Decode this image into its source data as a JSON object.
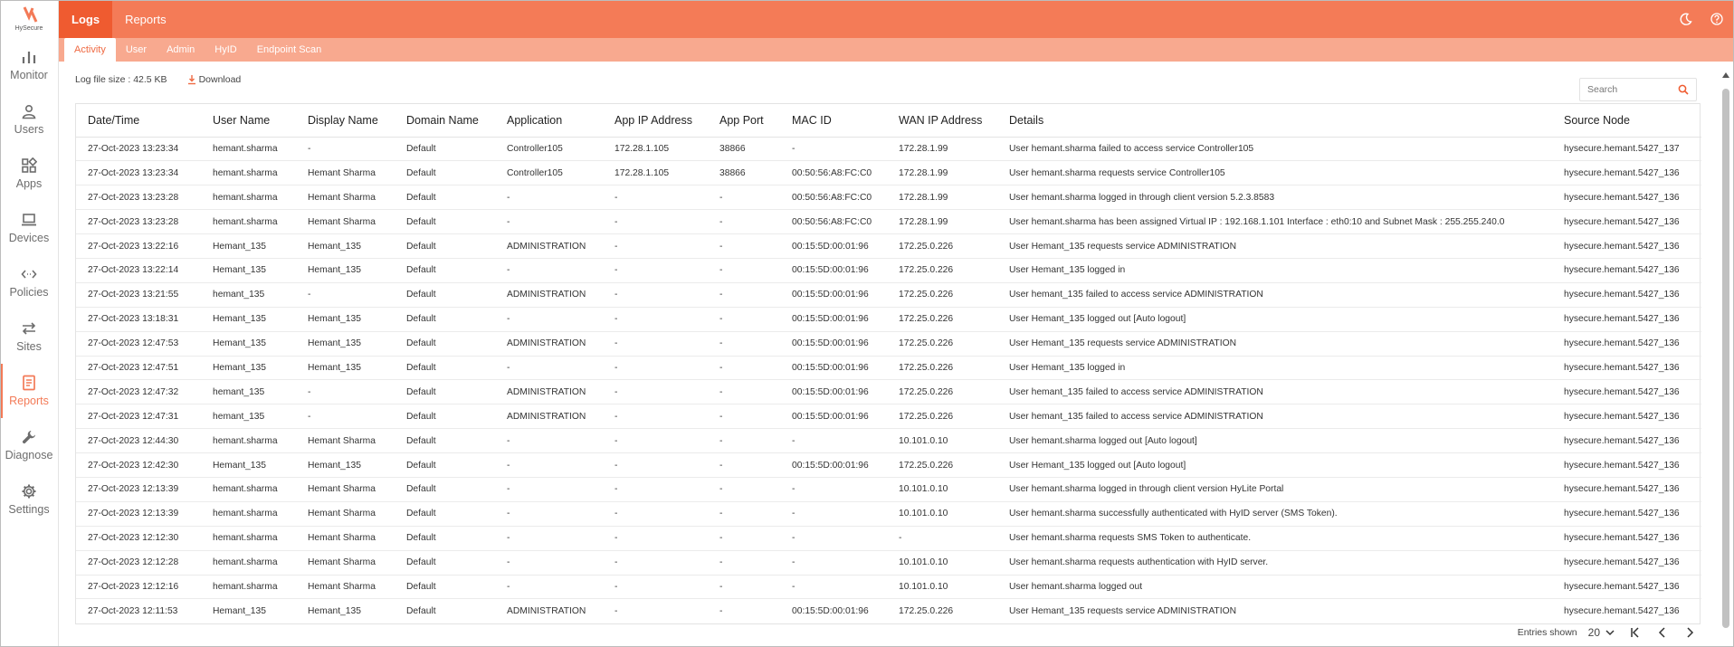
{
  "brand": {
    "name": "HySecure",
    "accent": "#f47b57",
    "accent_dark": "#ef5b30",
    "subbar": "#f8a98f"
  },
  "sidebar": {
    "items": [
      {
        "label": "Monitor",
        "icon": "bar-chart-icon"
      },
      {
        "label": "Users",
        "icon": "user-icon"
      },
      {
        "label": "Apps",
        "icon": "apps-grid-icon"
      },
      {
        "label": "Devices",
        "icon": "laptop-icon"
      },
      {
        "label": "Policies",
        "icon": "code-arrows-icon"
      },
      {
        "label": "Sites",
        "icon": "swap-arrows-icon"
      },
      {
        "label": "Reports",
        "icon": "report-icon",
        "active": true
      },
      {
        "label": "Diagnose",
        "icon": "wrench-icon"
      },
      {
        "label": "Settings",
        "icon": "gear-icon"
      }
    ]
  },
  "topbar": {
    "tabs": [
      {
        "label": "Logs",
        "active": true
      },
      {
        "label": "Reports"
      }
    ]
  },
  "subtabs": [
    {
      "label": "Activity",
      "active": true
    },
    {
      "label": "User"
    },
    {
      "label": "Admin"
    },
    {
      "label": "HyID"
    },
    {
      "label": "Endpoint Scan"
    }
  ],
  "toolbar": {
    "log_size": "Log file size : 42.5 KB",
    "download_label": "Download"
  },
  "search": {
    "placeholder": "Search"
  },
  "table": {
    "columns": [
      "Date/Time",
      "User Name",
      "Display Name",
      "Domain Name",
      "Application",
      "App IP Address",
      "App Port",
      "MAC ID",
      "WAN IP Address",
      "Details",
      "Source Node"
    ],
    "rows": [
      [
        "27-Oct-2023 13:23:34",
        "hemant.sharma",
        "-",
        "Default",
        "Controller105",
        "172.28.1.105",
        "38866",
        "-",
        "172.28.1.99",
        "User hemant.sharma failed to access service Controller105",
        "hysecure.hemant.5427_137"
      ],
      [
        "27-Oct-2023 13:23:34",
        "hemant.sharma",
        "Hemant Sharma",
        "Default",
        "Controller105",
        "172.28.1.105",
        "38866",
        "00:50:56:A8:FC:C0",
        "172.28.1.99",
        "User hemant.sharma requests service Controller105",
        "hysecure.hemant.5427_136"
      ],
      [
        "27-Oct-2023 13:23:28",
        "hemant.sharma",
        "Hemant Sharma",
        "Default",
        "-",
        "-",
        "-",
        "00:50:56:A8:FC:C0",
        "172.28.1.99",
        "User hemant.sharma logged in through client version 5.2.3.8583",
        "hysecure.hemant.5427_136"
      ],
      [
        "27-Oct-2023 13:23:28",
        "hemant.sharma",
        "Hemant Sharma",
        "Default",
        "-",
        "-",
        "-",
        "00:50:56:A8:FC:C0",
        "172.28.1.99",
        "User hemant.sharma has been assigned Virtual IP : 192.168.1.101 Interface : eth0:10 and Subnet Mask : 255.255.240.0",
        "hysecure.hemant.5427_136"
      ],
      [
        "27-Oct-2023 13:22:16",
        "Hemant_135",
        "Hemant_135",
        "Default",
        "ADMINISTRATION",
        "-",
        "-",
        "00:15:5D:00:01:96",
        "172.25.0.226",
        "User Hemant_135 requests service ADMINISTRATION",
        "hysecure.hemant.5427_136"
      ],
      [
        "27-Oct-2023 13:22:14",
        "Hemant_135",
        "Hemant_135",
        "Default",
        "-",
        "-",
        "-",
        "00:15:5D:00:01:96",
        "172.25.0.226",
        "User Hemant_135 logged in",
        "hysecure.hemant.5427_136"
      ],
      [
        "27-Oct-2023 13:21:55",
        "hemant_135",
        "-",
        "Default",
        "ADMINISTRATION",
        "-",
        "-",
        "00:15:5D:00:01:96",
        "172.25.0.226",
        "User hemant_135 failed to access service ADMINISTRATION",
        "hysecure.hemant.5427_136"
      ],
      [
        "27-Oct-2023 13:18:31",
        "Hemant_135",
        "Hemant_135",
        "Default",
        "-",
        "-",
        "-",
        "00:15:5D:00:01:96",
        "172.25.0.226",
        "User Hemant_135 logged out [Auto logout]",
        "hysecure.hemant.5427_136"
      ],
      [
        "27-Oct-2023 12:47:53",
        "Hemant_135",
        "Hemant_135",
        "Default",
        "ADMINISTRATION",
        "-",
        "-",
        "00:15:5D:00:01:96",
        "172.25.0.226",
        "User Hemant_135 requests service ADMINISTRATION",
        "hysecure.hemant.5427_136"
      ],
      [
        "27-Oct-2023 12:47:51",
        "Hemant_135",
        "Hemant_135",
        "Default",
        "-",
        "-",
        "-",
        "00:15:5D:00:01:96",
        "172.25.0.226",
        "User Hemant_135 logged in",
        "hysecure.hemant.5427_136"
      ],
      [
        "27-Oct-2023 12:47:32",
        "hemant_135",
        "-",
        "Default",
        "ADMINISTRATION",
        "-",
        "-",
        "00:15:5D:00:01:96",
        "172.25.0.226",
        "User hemant_135 failed to access service ADMINISTRATION",
        "hysecure.hemant.5427_136"
      ],
      [
        "27-Oct-2023 12:47:31",
        "hemant_135",
        "-",
        "Default",
        "ADMINISTRATION",
        "-",
        "-",
        "00:15:5D:00:01:96",
        "172.25.0.226",
        "User hemant_135 failed to access service ADMINISTRATION",
        "hysecure.hemant.5427_136"
      ],
      [
        "27-Oct-2023 12:44:30",
        "hemant.sharma",
        "Hemant Sharma",
        "Default",
        "-",
        "-",
        "-",
        "-",
        "10.101.0.10",
        "User hemant.sharma logged out [Auto logout]",
        "hysecure.hemant.5427_136"
      ],
      [
        "27-Oct-2023 12:42:30",
        "Hemant_135",
        "Hemant_135",
        "Default",
        "-",
        "-",
        "-",
        "00:15:5D:00:01:96",
        "172.25.0.226",
        "User Hemant_135 logged out [Auto logout]",
        "hysecure.hemant.5427_136"
      ],
      [
        "27-Oct-2023 12:13:39",
        "hemant.sharma",
        "Hemant Sharma",
        "Default",
        "-",
        "-",
        "-",
        "-",
        "10.101.0.10",
        "User hemant.sharma logged in through client version HyLite Portal",
        "hysecure.hemant.5427_136"
      ],
      [
        "27-Oct-2023 12:13:39",
        "hemant.sharma",
        "Hemant Sharma",
        "Default",
        "-",
        "-",
        "-",
        "-",
        "10.101.0.10",
        "User hemant.sharma successfully authenticated with HyID server (SMS Token).",
        "hysecure.hemant.5427_136"
      ],
      [
        "27-Oct-2023 12:12:30",
        "hemant.sharma",
        "Hemant Sharma",
        "Default",
        "-",
        "-",
        "-",
        "-",
        "-",
        "User hemant.sharma requests SMS Token to authenticate.",
        "hysecure.hemant.5427_136"
      ],
      [
        "27-Oct-2023 12:12:28",
        "hemant.sharma",
        "Hemant Sharma",
        "Default",
        "-",
        "-",
        "-",
        "-",
        "10.101.0.10",
        "User hemant.sharma requests authentication with HyID server.",
        "hysecure.hemant.5427_136"
      ],
      [
        "27-Oct-2023 12:12:16",
        "hemant.sharma",
        "Hemant Sharma",
        "Default",
        "-",
        "-",
        "-",
        "-",
        "10.101.0.10",
        "User hemant.sharma logged out",
        "hysecure.hemant.5427_136"
      ],
      [
        "27-Oct-2023 12:11:53",
        "Hemant_135",
        "Hemant_135",
        "Default",
        "ADMINISTRATION",
        "-",
        "-",
        "00:15:5D:00:01:96",
        "172.25.0.226",
        "User Hemant_135 requests service ADMINISTRATION",
        "hysecure.hemant.5427_136"
      ]
    ]
  },
  "footer": {
    "entries_label": "Entries shown",
    "entries_value": "20"
  }
}
